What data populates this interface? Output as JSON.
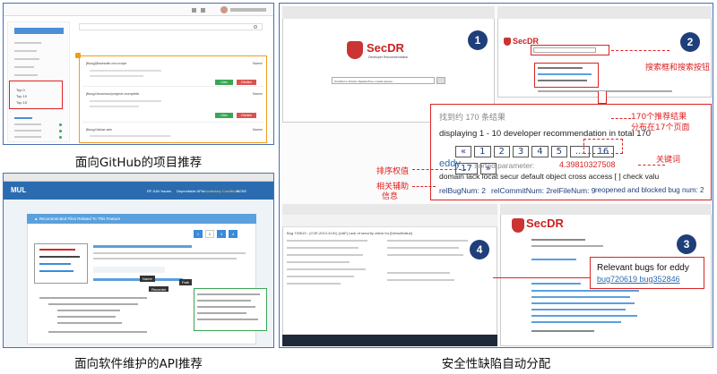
{
  "captions": {
    "github": "面向GitHub的项目推荐",
    "api": "面向软件维护的API推荐",
    "security": "安全性缺陷自动分配"
  },
  "github_panel": {
    "project_cards": [
      {
        "name": "jfloog/jfloorsafe-om-norpe",
        "tag": "Nome"
      },
      {
        "name": "jfloog/Jsoonsvc/projectr-ecmplete",
        "tag": "Nome"
      },
      {
        "name": "jfloog/Jalcar-aen",
        "tag": "Nome"
      }
    ],
    "sidebar_items": [
      "Top 0",
      "Top 10",
      "Top 15"
    ],
    "buttons": {
      "like": "Like",
      "dislike": "Dislike"
    }
  },
  "api_panel": {
    "logo": "MUL",
    "nav": [
      "RF-SAV  Issues",
      "Dependable APIs",
      "Vocabulary Conditions",
      "BCNE"
    ],
    "banner": "▲ Recommended Files Related To This Feature",
    "pages": [
      "1",
      "2",
      "3",
      "4"
    ],
    "tooltips": {
      "name": "Name",
      "recorder": "Recorder",
      "path": "Path"
    }
  },
  "secdr": {
    "brand": "SecDR",
    "subtitle": "Developer Recommendation",
    "search_placeholder": "OneShot in Firefox: ReplaceTree: unsafe access...",
    "circle_labels": [
      "1",
      "2",
      "3",
      "4"
    ],
    "result_count_label": "找到约 170 条结果",
    "displaying": "displaying 1 - 10 developer recommendation in total 170",
    "pages": [
      "«",
      "1",
      "2",
      "3",
      "4",
      "5",
      "...",
      "16",
      "17",
      "»"
    ],
    "developer": "eddy",
    "sorted_param_label": "- sorted parameter:",
    "sorted_param_value": "4.39810327508",
    "keywords": "domain lack locat secur default object cross access [ ] check valu",
    "stats": [
      "relBugNum: 2",
      "relCommitNum: 2",
      "relFileNum: 9",
      "reopened and blocked bug num: 2"
    ],
    "relevant_bugs_title": "Relevant bugs for eddy",
    "relevant_bugs": "bug720619 bug352846",
    "annotations": {
      "search": "搜索框和搜索按钮",
      "pages_note_1": "170个推荐结果",
      "pages_note_2": "分布在17个页面",
      "keywords": "关键词",
      "ranking": "排序权值",
      "info_1": "相关辅助",
      "info_2": "信息"
    },
    "browser_title": "SecDR",
    "bug_header": "Bug 720619 - (CVE-2012-4191) [UAF] Lack of security check for [DefaultValue]"
  },
  "colors": {
    "frame": "#4a6fb5",
    "red": "#dd2222",
    "navy": "#1f3f7a",
    "green": "#3aa655",
    "orange": "#f39c12"
  }
}
